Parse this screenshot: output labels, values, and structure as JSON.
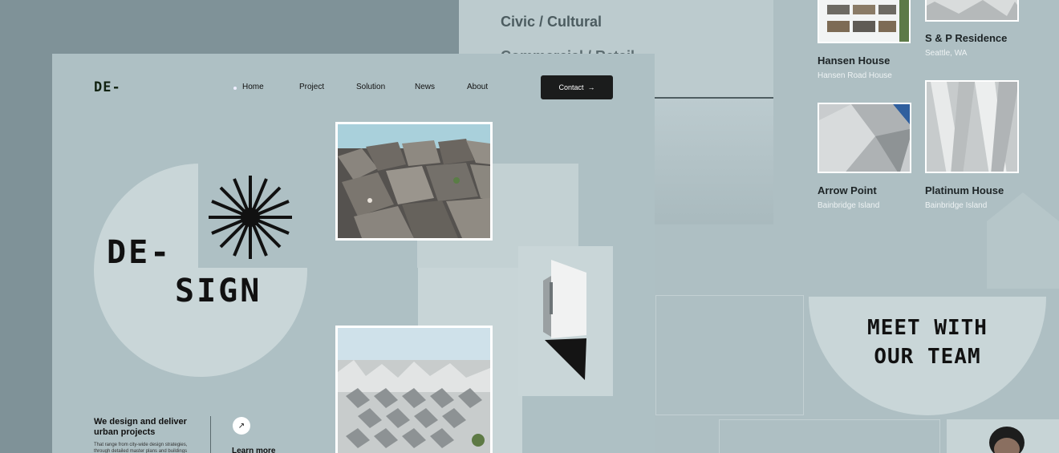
{
  "background_page": {
    "categories": [
      "Civic / Cultural",
      "Commercial / Retail"
    ],
    "projects": [
      {
        "name": "Hansen House",
        "location": "Hansen Road House"
      },
      {
        "name": "S & P Residence",
        "location": "Seattle, WA"
      },
      {
        "name": "Arrow Point",
        "location": "Bainbridge Island"
      },
      {
        "name": "Platinum House",
        "location": "Bainbridge Island"
      }
    ],
    "team_heading_line1": "MEET WITH",
    "team_heading_line2": "OUR TEAM"
  },
  "main_page": {
    "logo": "DE-",
    "nav": {
      "items": [
        "Home",
        "Project",
        "Solution",
        "News",
        "About"
      ],
      "active": "Home"
    },
    "contact_button": "Contact",
    "hero_line1": "DE-",
    "hero_line2": "SIGN",
    "tagline": "We design and deliver urban  projects",
    "description": "That range from city-wide design strategies, through detailed master plans and buildings",
    "learn_more": "Learn more"
  },
  "colors": {
    "page_bg": "#7f9298",
    "main_bg": "#aec0c4",
    "accent_dark": "#1b1c1c",
    "light_shape": "#c9d6d8"
  },
  "icons": [
    "sunburst-icon",
    "arrow-right-icon",
    "arrow-up-right-icon"
  ]
}
